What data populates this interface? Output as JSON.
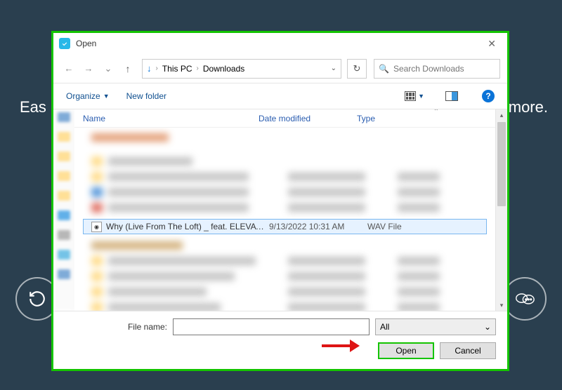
{
  "backdrop": {
    "left_text": "Eas",
    "right_text": "more."
  },
  "dialog": {
    "title": "Open",
    "close": "✕"
  },
  "nav": {
    "back": "←",
    "forward": "→",
    "chevron": "⌄",
    "up": "↑",
    "breadcrumb_icon": "↓",
    "path1": "This PC",
    "path2": "Downloads",
    "sep": "›",
    "dropdown": "⌄",
    "refresh": "↻"
  },
  "search": {
    "placeholder": "Search Downloads"
  },
  "toolbar": {
    "organize": "Organize",
    "organize_dd": "▼",
    "new_folder": "New folder",
    "view_dd": "▼",
    "help": "?"
  },
  "columns": {
    "name": "Name",
    "date": "Date modified",
    "type": "Type"
  },
  "selected": {
    "name": "Why (Live From The Loft) _ feat. ELEVATI...",
    "date": "9/13/2022 10:31 AM",
    "type": "WAV File"
  },
  "footer": {
    "filename_label": "File name:",
    "filename_value": "",
    "filter": "All",
    "open": "Open",
    "cancel": "Cancel"
  },
  "chart_data": null
}
